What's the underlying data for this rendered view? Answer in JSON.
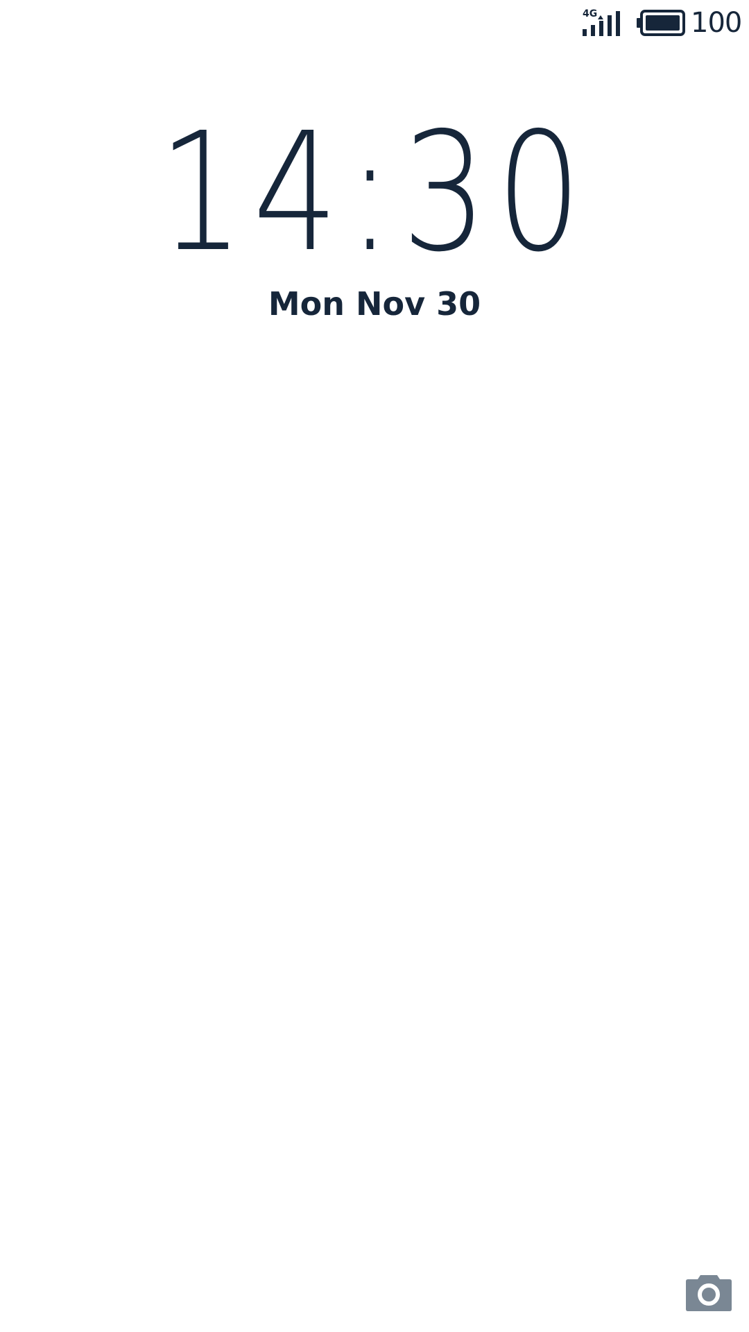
{
  "status_bar": {
    "network_type": "4G",
    "signal_icon": "cellular-signal-icon",
    "battery_icon": "battery-full-icon",
    "battery_level": "100"
  },
  "lock_screen": {
    "time": "14:30",
    "date": "Mon Nov 30"
  },
  "shortcuts": {
    "camera_icon": "camera-icon"
  },
  "colors": {
    "text": "#16263a",
    "background": "#ffffff",
    "camera_icon": "#7a8794"
  }
}
